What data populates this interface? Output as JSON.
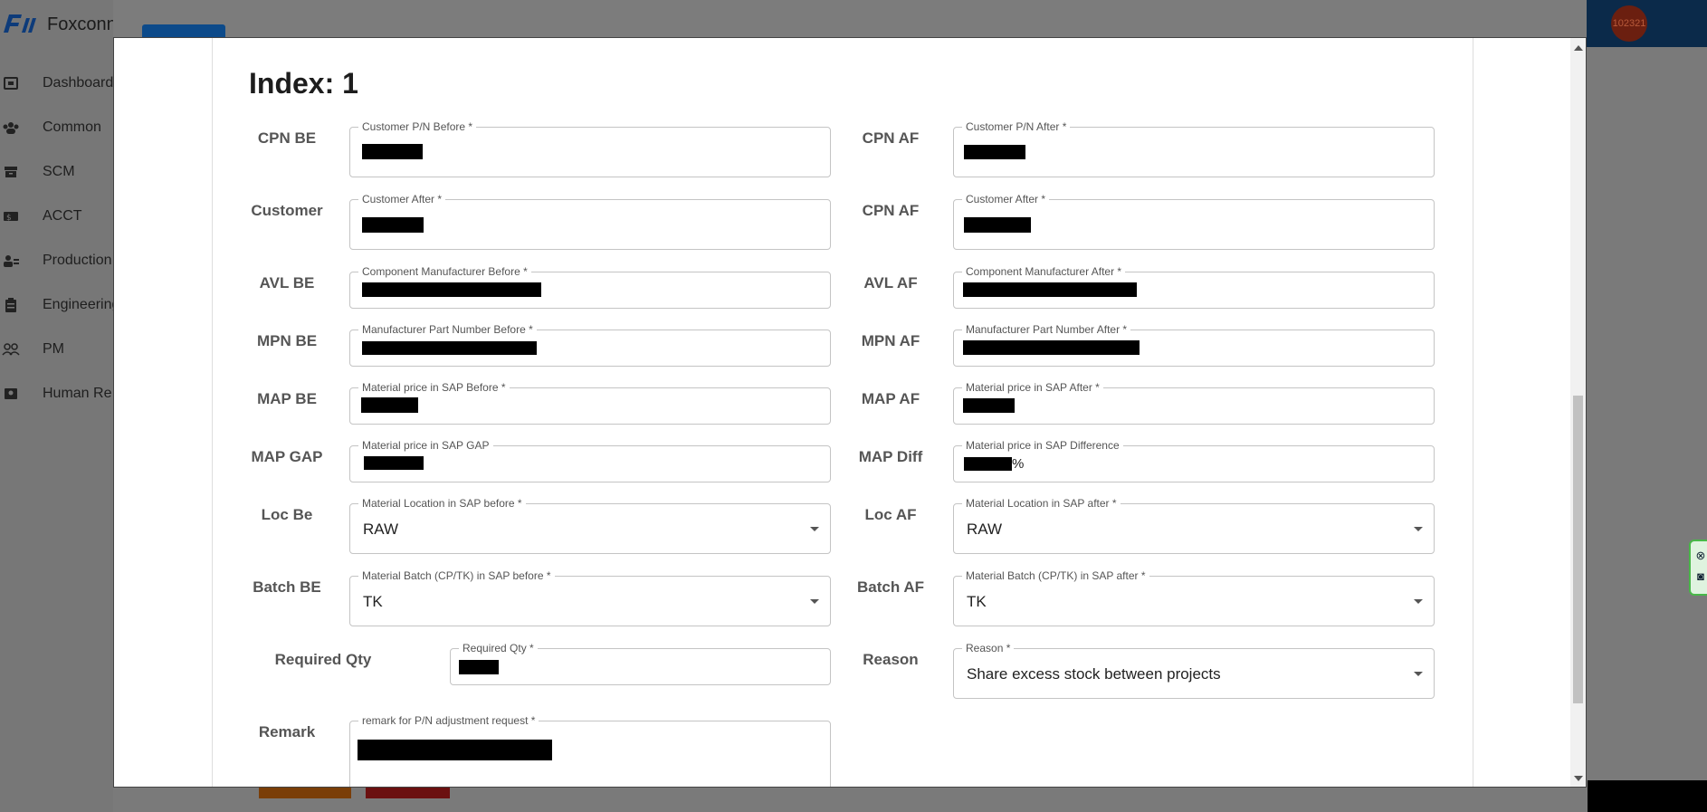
{
  "app": {
    "brand": "Foxconn",
    "avatar_text": "102321",
    "nav": [
      "Dashboard",
      "Common",
      "SCM",
      "ACCT",
      "Production",
      "Engineering",
      "PM",
      "Human Re"
    ]
  },
  "dialog": {
    "index_title": "Index: 1",
    "rows": [
      {
        "left_label": "CPN BE",
        "left_legend": "Customer P/N Before *",
        "right_label": "CPN AF",
        "right_legend": "Customer P/N After *"
      },
      {
        "left_label": "Customer",
        "left_legend": "Customer After *",
        "right_label": "CPN AF",
        "right_legend": "Customer After *"
      },
      {
        "left_label": "AVL BE",
        "left_legend": "Component Manufacturer Before *",
        "right_label": "AVL AF",
        "right_legend": "Component Manufacturer After *"
      },
      {
        "left_label": "MPN BE",
        "left_legend": "Manufacturer Part Number Before *",
        "right_label": "MPN AF",
        "right_legend": "Manufacturer Part Number After *"
      },
      {
        "left_label": "MAP BE",
        "left_legend": "Material price in SAP Before *",
        "right_label": "MAP AF",
        "right_legend": "Material price in SAP After *"
      },
      {
        "left_label": "MAP GAP",
        "left_legend": "Material price in SAP GAP",
        "right_label": "MAP Diff",
        "right_legend": "Material price in SAP Difference",
        "right_suffix": "%"
      },
      {
        "left_label": "Loc Be",
        "left_legend": "Material Location in SAP before *",
        "left_value": "RAW",
        "right_label": "Loc AF",
        "right_legend": "Material Location in SAP after *",
        "right_value": "RAW"
      },
      {
        "left_label": "Batch BE",
        "left_legend": "Material Batch (CP/TK) in SAP before *",
        "left_value": "TK",
        "right_label": "Batch AF",
        "right_legend": "Material Batch (CP/TK) in SAP after *",
        "right_value": "TK"
      },
      {
        "left_label": "Required Qty",
        "left_legend": "Required Qty *",
        "right_label": "Reason",
        "right_legend": "Reason *",
        "right_value": "Share excess stock between projects"
      },
      {
        "left_label": "Remark",
        "left_legend": "remark for P/N adjustment request *"
      }
    ]
  }
}
